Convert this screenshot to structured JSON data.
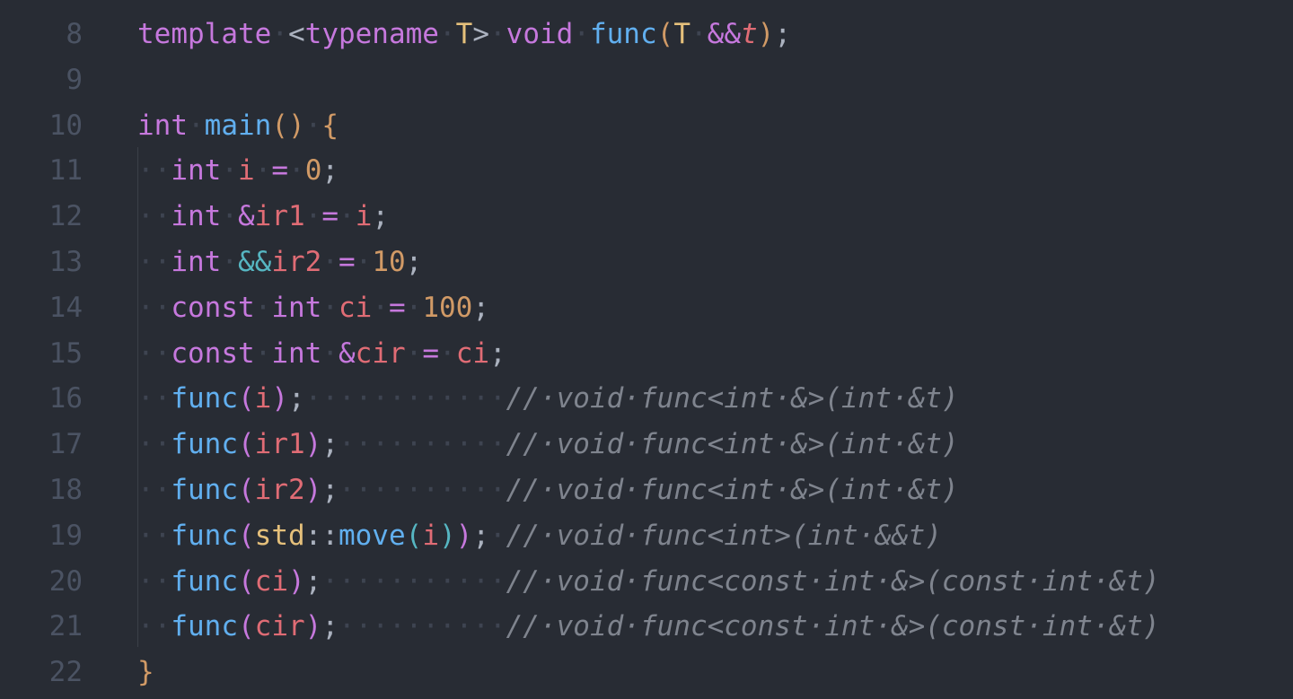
{
  "editor": {
    "line_numbers": [
      "8",
      "9",
      "10",
      "11",
      "12",
      "13",
      "14",
      "15",
      "16",
      "17",
      "18",
      "19",
      "20",
      "21",
      "22"
    ],
    "lines": [
      {
        "tokens": [
          {
            "text": "template",
            "kind": "k"
          },
          {
            "text": "·",
            "kind": "ws"
          },
          {
            "text": "<",
            "kind": "p"
          },
          {
            "text": "typename",
            "kind": "k"
          },
          {
            "text": "·",
            "kind": "ws"
          },
          {
            "text": "T",
            "kind": "t"
          },
          {
            "text": ">",
            "kind": "p"
          },
          {
            "text": "·",
            "kind": "ws"
          },
          {
            "text": "void",
            "kind": "k"
          },
          {
            "text": "·",
            "kind": "ws"
          },
          {
            "text": "func",
            "kind": "f"
          },
          {
            "text": "(",
            "kind": "b1"
          },
          {
            "text": "T",
            "kind": "t"
          },
          {
            "text": "·",
            "kind": "ws"
          },
          {
            "text": "&&",
            "kind": "k"
          },
          {
            "text": "t",
            "kind": "v-it"
          },
          {
            "text": ")",
            "kind": "b1"
          },
          {
            "text": ";",
            "kind": "p"
          }
        ]
      },
      {
        "tokens": []
      },
      {
        "tokens": [
          {
            "text": "int",
            "kind": "k"
          },
          {
            "text": "·",
            "kind": "ws"
          },
          {
            "text": "main",
            "kind": "f"
          },
          {
            "text": "()",
            "kind": "b1"
          },
          {
            "text": "·",
            "kind": "ws"
          },
          {
            "text": "{",
            "kind": "b1"
          }
        ]
      },
      {
        "tokens": [
          {
            "text": "··",
            "kind": "ws"
          },
          {
            "text": "int",
            "kind": "k"
          },
          {
            "text": "·",
            "kind": "ws"
          },
          {
            "text": "i",
            "kind": "v"
          },
          {
            "text": "·",
            "kind": "ws"
          },
          {
            "text": "=",
            "kind": "k"
          },
          {
            "text": "·",
            "kind": "ws"
          },
          {
            "text": "0",
            "kind": "n"
          },
          {
            "text": ";",
            "kind": "p"
          }
        ]
      },
      {
        "tokens": [
          {
            "text": "··",
            "kind": "ws"
          },
          {
            "text": "int",
            "kind": "k"
          },
          {
            "text": "·",
            "kind": "ws"
          },
          {
            "text": "&",
            "kind": "k"
          },
          {
            "text": "ir1",
            "kind": "v"
          },
          {
            "text": "·",
            "kind": "ws"
          },
          {
            "text": "=",
            "kind": "k"
          },
          {
            "text": "·",
            "kind": "ws"
          },
          {
            "text": "i",
            "kind": "v"
          },
          {
            "text": ";",
            "kind": "p"
          }
        ]
      },
      {
        "tokens": [
          {
            "text": "··",
            "kind": "ws"
          },
          {
            "text": "int",
            "kind": "k"
          },
          {
            "text": "·",
            "kind": "ws"
          },
          {
            "text": "&&",
            "kind": "op"
          },
          {
            "text": "ir2",
            "kind": "v"
          },
          {
            "text": "·",
            "kind": "ws"
          },
          {
            "text": "=",
            "kind": "k"
          },
          {
            "text": "·",
            "kind": "ws"
          },
          {
            "text": "10",
            "kind": "n"
          },
          {
            "text": ";",
            "kind": "p"
          }
        ]
      },
      {
        "tokens": [
          {
            "text": "··",
            "kind": "ws"
          },
          {
            "text": "const",
            "kind": "k"
          },
          {
            "text": "·",
            "kind": "ws"
          },
          {
            "text": "int",
            "kind": "k"
          },
          {
            "text": "·",
            "kind": "ws"
          },
          {
            "text": "ci",
            "kind": "v"
          },
          {
            "text": "·",
            "kind": "ws"
          },
          {
            "text": "=",
            "kind": "k"
          },
          {
            "text": "·",
            "kind": "ws"
          },
          {
            "text": "100",
            "kind": "n"
          },
          {
            "text": ";",
            "kind": "p"
          }
        ]
      },
      {
        "tokens": [
          {
            "text": "··",
            "kind": "ws"
          },
          {
            "text": "const",
            "kind": "k"
          },
          {
            "text": "·",
            "kind": "ws"
          },
          {
            "text": "int",
            "kind": "k"
          },
          {
            "text": "·",
            "kind": "ws"
          },
          {
            "text": "&",
            "kind": "k"
          },
          {
            "text": "cir",
            "kind": "v"
          },
          {
            "text": "·",
            "kind": "ws"
          },
          {
            "text": "=",
            "kind": "k"
          },
          {
            "text": "·",
            "kind": "ws"
          },
          {
            "text": "ci",
            "kind": "v"
          },
          {
            "text": ";",
            "kind": "p"
          }
        ]
      },
      {
        "tokens": [
          {
            "text": "··",
            "kind": "ws"
          },
          {
            "text": "func",
            "kind": "f"
          },
          {
            "text": "(",
            "kind": "b2"
          },
          {
            "text": "i",
            "kind": "v"
          },
          {
            "text": ")",
            "kind": "b2"
          },
          {
            "text": ";",
            "kind": "p"
          },
          {
            "text": "············",
            "kind": "ws"
          },
          {
            "text": "//·void·func<int·&>(int·&t)",
            "kind": "c"
          }
        ]
      },
      {
        "tokens": [
          {
            "text": "··",
            "kind": "ws"
          },
          {
            "text": "func",
            "kind": "f"
          },
          {
            "text": "(",
            "kind": "b2"
          },
          {
            "text": "ir1",
            "kind": "v"
          },
          {
            "text": ")",
            "kind": "b2"
          },
          {
            "text": ";",
            "kind": "p"
          },
          {
            "text": "··········",
            "kind": "ws"
          },
          {
            "text": "//·void·func<int·&>(int·&t)",
            "kind": "c"
          }
        ]
      },
      {
        "tokens": [
          {
            "text": "··",
            "kind": "ws"
          },
          {
            "text": "func",
            "kind": "f"
          },
          {
            "text": "(",
            "kind": "b2"
          },
          {
            "text": "ir2",
            "kind": "v"
          },
          {
            "text": ")",
            "kind": "b2"
          },
          {
            "text": ";",
            "kind": "p"
          },
          {
            "text": "··········",
            "kind": "ws"
          },
          {
            "text": "//·void·func<int·&>(int·&t)",
            "kind": "c"
          }
        ]
      },
      {
        "tokens": [
          {
            "text": "··",
            "kind": "ws"
          },
          {
            "text": "func",
            "kind": "f"
          },
          {
            "text": "(",
            "kind": "b2"
          },
          {
            "text": "std",
            "kind": "t"
          },
          {
            "text": "::",
            "kind": "p"
          },
          {
            "text": "move",
            "kind": "f"
          },
          {
            "text": "(",
            "kind": "b3"
          },
          {
            "text": "i",
            "kind": "v"
          },
          {
            "text": ")",
            "kind": "b3"
          },
          {
            "text": ")",
            "kind": "b2"
          },
          {
            "text": ";",
            "kind": "p"
          },
          {
            "text": "·",
            "kind": "ws"
          },
          {
            "text": "//·void·func<int>(int·&&t)",
            "kind": "c"
          }
        ]
      },
      {
        "tokens": [
          {
            "text": "··",
            "kind": "ws"
          },
          {
            "text": "func",
            "kind": "f"
          },
          {
            "text": "(",
            "kind": "b2"
          },
          {
            "text": "ci",
            "kind": "v"
          },
          {
            "text": ")",
            "kind": "b2"
          },
          {
            "text": ";",
            "kind": "p"
          },
          {
            "text": "···········",
            "kind": "ws"
          },
          {
            "text": "//·void·func<const·int·&>(const·int·&t)",
            "kind": "c"
          }
        ]
      },
      {
        "tokens": [
          {
            "text": "··",
            "kind": "ws"
          },
          {
            "text": "func",
            "kind": "f"
          },
          {
            "text": "(",
            "kind": "b2"
          },
          {
            "text": "cir",
            "kind": "v"
          },
          {
            "text": ")",
            "kind": "b2"
          },
          {
            "text": ";",
            "kind": "p"
          },
          {
            "text": "··········",
            "kind": "ws"
          },
          {
            "text": "//·void·func<const·int·&>(const·int·&t)",
            "kind": "c"
          }
        ]
      },
      {
        "tokens": [
          {
            "text": "}",
            "kind": "b1"
          }
        ]
      }
    ]
  }
}
